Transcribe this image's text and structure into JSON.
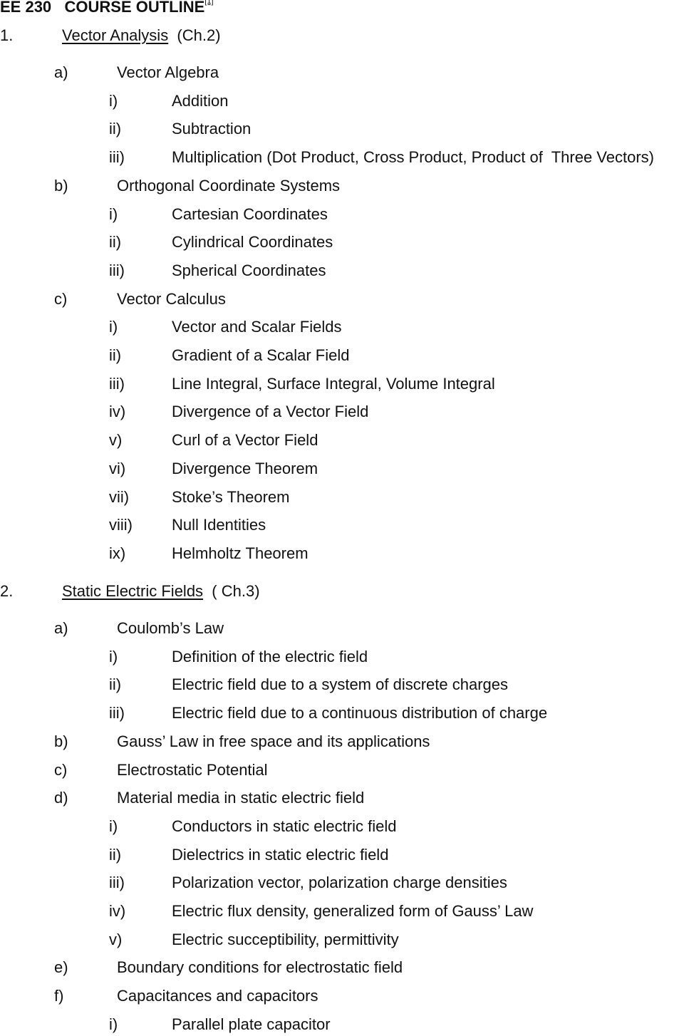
{
  "document": {
    "title": "EE 230   COURSE OUTLINE",
    "footnote_ref": "[1]",
    "sections": [
      {
        "number": "1.",
        "title": "Vector Analysis",
        "chapter": "(Ch.2)",
        "items": [
          {
            "label": "a)",
            "text": "Vector Algebra",
            "subitems": [
              {
                "label": "i)",
                "text": "Addition"
              },
              {
                "label": "ii)",
                "text": "Subtraction"
              },
              {
                "label": "iii)",
                "text": "Multiplication (Dot Product, Cross Product, Product of  Three Vectors)"
              }
            ]
          },
          {
            "label": "b)",
            "text": "Orthogonal Coordinate Systems",
            "subitems": [
              {
                "label": "i)",
                "text": "Cartesian Coordinates"
              },
              {
                "label": "ii)",
                "text": "Cylindrical Coordinates"
              },
              {
                "label": "iii)",
                "text": "Spherical Coordinates"
              }
            ]
          },
          {
            "label": "c)",
            "text": "Vector Calculus",
            "subitems": [
              {
                "label": "i)",
                "text": "Vector and Scalar Fields"
              },
              {
                "label": "ii)",
                "text": "Gradient of a Scalar Field"
              },
              {
                "label": "iii)",
                "text": "Line Integral, Surface Integral, Volume Integral"
              },
              {
                "label": "iv)",
                "text": "Divergence of a Vector Field"
              },
              {
                "label": "v)",
                "text": "Curl of a Vector Field"
              },
              {
                "label": "vi)",
                "text": "Divergence Theorem"
              },
              {
                "label": "vii)",
                "text": "Stoke’s Theorem"
              },
              {
                "label": "viii)",
                "text": "Null Identities"
              },
              {
                "label": "ix)",
                "text": "Helmholtz Theorem"
              }
            ]
          }
        ]
      },
      {
        "number": "2.",
        "title": "Static Electric Fields",
        "chapter": "( Ch.3)",
        "items": [
          {
            "label": "a)",
            "text": "Coulomb’s Law",
            "subitems": [
              {
                "label": "i)",
                "text": "Definition of the electric field"
              },
              {
                "label": "ii)",
                "text": "Electric field due to a system of discrete charges"
              },
              {
                "label": "iii)",
                "text": "Electric field due to a continuous distribution of charge"
              }
            ]
          },
          {
            "label": "b)",
            "text": "Gauss’ Law in free space and its applications",
            "subitems": []
          },
          {
            "label": "c)",
            "text": "Electrostatic Potential",
            "subitems": []
          },
          {
            "label": "d)",
            "text": "Material media in static electric field",
            "subitems": [
              {
                "label": "i)",
                "text": "Conductors in static electric field"
              },
              {
                "label": "ii)",
                "text": "Dielectrics in static electric field"
              },
              {
                "label": "iii)",
                "text": "Polarization vector, polarization charge densities"
              },
              {
                "label": "iv)",
                "text": "Electric flux density, generalized form of Gauss’ Law"
              },
              {
                "label": "v)",
                "text": "Electric succeptibility, permittivity"
              }
            ]
          },
          {
            "label": "e)",
            "text": "Boundary conditions for electrostatic field",
            "subitems": []
          },
          {
            "label": "f)",
            "text": "Capacitances and capacitors",
            "subitems": [
              {
                "label": "i)",
                "text": "Parallel plate capacitor"
              }
            ]
          }
        ]
      }
    ]
  }
}
